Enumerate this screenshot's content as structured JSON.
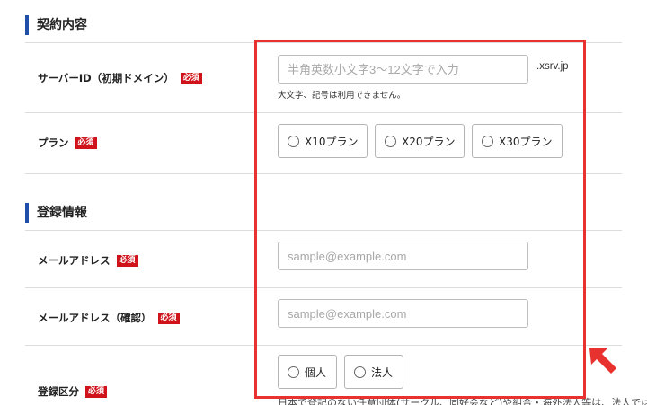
{
  "sections": {
    "contract": {
      "title": "契約内容"
    },
    "registration": {
      "title": "登録情報"
    }
  },
  "required_badge": "必須",
  "server_id": {
    "label": "サーバーID（初期ドメイン）",
    "placeholder": "半角英数小文字3〜12文字で入力",
    "suffix": ".xsrv.jp",
    "help": "大文字、記号は利用できません。"
  },
  "plan": {
    "label": "プラン",
    "options": [
      "X10プラン",
      "X20プラン",
      "X30プラン"
    ]
  },
  "email": {
    "label": "メールアドレス",
    "placeholder": "sample@example.com"
  },
  "email_confirm": {
    "label": "メールアドレス（確認）",
    "placeholder": "sample@example.com"
  },
  "registration_type": {
    "label": "登録区分",
    "options": [
      "個人",
      "法人"
    ],
    "note": "日本で登記のない任意団体(サークル、同好会など)や組合・海外法人等は、法人ではな"
  },
  "colors": {
    "accent_blue": "#1f4fa8",
    "required_red": "#d0121b",
    "highlight_red": "#e8322f"
  }
}
